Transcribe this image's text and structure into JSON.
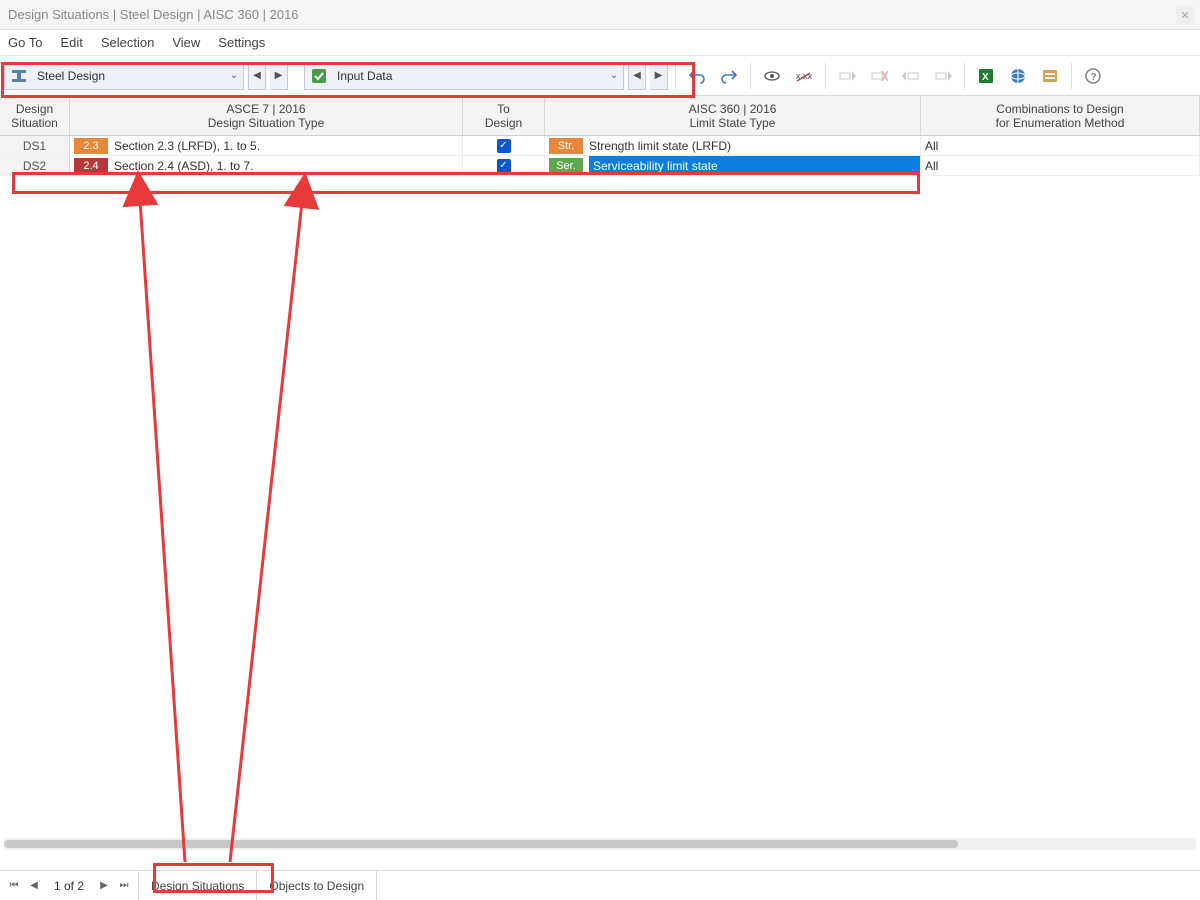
{
  "window": {
    "title": "Design Situations | Steel Design | AISC 360 | 2016"
  },
  "menu": {
    "items": [
      "Go To",
      "Edit",
      "Selection",
      "View",
      "Settings"
    ]
  },
  "toolbar": {
    "combo1": {
      "label": "Steel Design"
    },
    "combo2": {
      "label": "Input Data"
    }
  },
  "grid": {
    "headers": {
      "id_line1": "Design",
      "id_line2": "Situation",
      "type_line1": "ASCE 7 | 2016",
      "type_line2": "Design Situation Type",
      "todesign_line1": "To",
      "todesign_line2": "Design",
      "limit_line1": "AISC 360 | 2016",
      "limit_line2": "Limit State Type",
      "combo_line1": "Combinations to Design",
      "combo_line2": "for Enumeration Method"
    },
    "rows": [
      {
        "id": "DS1",
        "type_badge": "2.3",
        "type_text": "Section 2.3 (LRFD), 1. to 5.",
        "to_design": true,
        "limit_badge": "Str.",
        "limit_text": "Strength limit state (LRFD)",
        "limit_selected": false,
        "combo": "All"
      },
      {
        "id": "DS2",
        "type_badge": "2.4",
        "type_text": "Section 2.4 (ASD), 1. to 7.",
        "to_design": true,
        "limit_badge": "Ser.",
        "limit_text": "Serviceability limit state",
        "limit_selected": true,
        "combo": "All"
      }
    ]
  },
  "footer": {
    "page_text": "1 of 2",
    "tabs": [
      "Design Situations",
      "Objects to Design"
    ]
  }
}
